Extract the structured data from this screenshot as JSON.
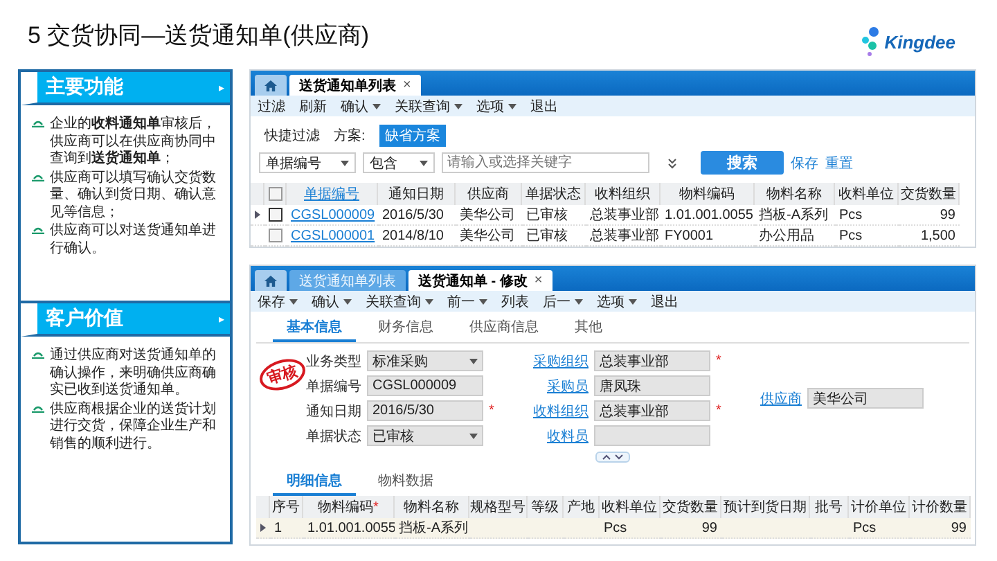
{
  "slide": {
    "title": "5 交货协同—送货通知单(供应商)",
    "logo": "Kingdee"
  },
  "panels": [
    {
      "title": "主要功能",
      "arrow": "▸",
      "bullets": [
        "企业的**收料通知单**审核后，供应商可以在供应商协同中查询到**送货通知单**；",
        "供应商可以填写确认交货数量、确认到货日期、确认意见等信息；",
        "供应商可以对送货通知单进行确认。"
      ]
    },
    {
      "title": "客户价值",
      "arrow": "▸",
      "bullets": [
        "通过供应商对送货通知单的确认操作，来明确供应商确实已收到送货通知单。",
        "供应商根据企业的送货计划进行交货，保障企业生产和销售的顺利进行。"
      ]
    }
  ],
  "list_window": {
    "tabs": [
      {
        "kind": "home",
        "selected": false
      },
      {
        "kind": "text",
        "label": "送货通知单列表",
        "selected": true,
        "close": "×"
      }
    ],
    "toolbar": [
      {
        "label": "过滤",
        "dropdown": false
      },
      {
        "label": "刷新",
        "dropdown": false
      },
      {
        "label": "确认",
        "dropdown": true
      },
      {
        "label": "关联查询",
        "dropdown": true
      },
      {
        "label": "选项",
        "dropdown": true
      },
      {
        "label": "退出",
        "dropdown": false
      }
    ],
    "quick_filter": "快捷过滤",
    "scheme_label": "方案:",
    "schemes": [
      {
        "label": "缺省方案",
        "selected": true
      }
    ],
    "filter_field": "单据编号",
    "filter_operator": "包含",
    "keyword": {
      "placeholder": "请输入或选择关键字"
    },
    "search_button": "搜索",
    "links": [
      "保存",
      "重置"
    ],
    "select_all": {
      "checked": false
    },
    "columns": [
      {
        "label": "单据编号",
        "link": true
      },
      {
        "label": "通知日期",
        "link": false
      },
      {
        "label": "供应商",
        "link": false
      },
      {
        "label": "单据状态",
        "link": false
      },
      {
        "label": "收料组织",
        "link": false
      },
      {
        "label": "物料编码",
        "link": false
      },
      {
        "label": "物料名称",
        "link": false
      },
      {
        "label": "收料单位",
        "link": false
      },
      {
        "label": "交货数量",
        "link": false,
        "numeric": true
      }
    ],
    "rows": [
      {
        "current": true,
        "checked": false,
        "cells": [
          "CGSL000009",
          "2016/5/30",
          "美华公司",
          "已审核",
          "总装事业部",
          "1.01.001.0055",
          "挡板-A系列",
          "Pcs",
          "99"
        ]
      },
      {
        "current": false,
        "checked": false,
        "cells": [
          "CGSL000001",
          "2014/8/10",
          "美华公司",
          "已审核",
          "总装事业部",
          "FY0001",
          "办公用品",
          "Pcs",
          "1,500"
        ]
      }
    ]
  },
  "edit_window": {
    "tabs": [
      {
        "kind": "home",
        "selected": false
      },
      {
        "kind": "text",
        "label": "送货通知单列表",
        "selected": false
      },
      {
        "kind": "text",
        "label": "送货通知单 - 修改",
        "selected": true,
        "close": "×"
      }
    ],
    "toolbar": [
      {
        "label": "保存",
        "dropdown": true
      },
      {
        "label": "确认",
        "dropdown": true
      },
      {
        "label": "关联查询",
        "dropdown": true
      },
      {
        "label": "前一",
        "dropdown": true
      },
      {
        "label": "列表",
        "dropdown": false
      },
      {
        "label": "后一",
        "dropdown": true
      },
      {
        "label": "选项",
        "dropdown": true
      },
      {
        "label": "退出",
        "dropdown": false
      }
    ],
    "sections": [
      {
        "label": "基本信息",
        "selected": true
      },
      {
        "label": "财务信息",
        "selected": false
      },
      {
        "label": "供应商信息",
        "selected": false
      },
      {
        "label": "其他",
        "selected": false
      }
    ],
    "stamp": "审核",
    "form_columns": [
      [
        {
          "label": "业务类型",
          "value": "标准采购",
          "kind": "select",
          "link": false
        },
        {
          "label": "单据编号",
          "value": "CGSL000009",
          "kind": "text",
          "link": false
        },
        {
          "label": "通知日期",
          "value": "2016/5/30",
          "kind": "text",
          "link": false,
          "required_mark": "*"
        },
        {
          "label": "单据状态",
          "value": "已审核",
          "kind": "select",
          "link": false
        }
      ],
      [
        {
          "label": "采购组织",
          "value": "总装事业部",
          "kind": "text",
          "link": true,
          "required_mark": "*"
        },
        {
          "label": "采购员",
          "value": "唐凤珠",
          "kind": "text",
          "link": true
        },
        {
          "label": "收料组织",
          "value": "总装事业部",
          "kind": "text",
          "link": true,
          "required_mark": "*"
        },
        {
          "label": "收料员",
          "kind": "text",
          "link": true
        }
      ],
      [
        {
          "label": "供应商",
          "value": "美华公司",
          "kind": "text",
          "link": true
        }
      ]
    ],
    "detail_tabs": [
      {
        "label": "明细信息",
        "selected": true
      },
      {
        "label": "物料数据",
        "selected": false
      }
    ],
    "detail_columns": [
      {
        "label": "序号"
      },
      {
        "label": "物料编码",
        "required_mark": "*"
      },
      {
        "label": "物料名称"
      },
      {
        "label": "规格型号"
      },
      {
        "label": "等级"
      },
      {
        "label": "产地"
      },
      {
        "label": "收料单位"
      },
      {
        "label": "交货数量",
        "numeric": true
      },
      {
        "label": "预计到货日期"
      },
      {
        "label": "批号"
      },
      {
        "label": "计价单位"
      },
      {
        "label": "计价数量",
        "numeric": true
      }
    ],
    "detail_rows": [
      {
        "current": true,
        "cells": [
          "1",
          "1.01.001.0055",
          "挡板-A系列",
          null,
          null,
          null,
          "Pcs",
          "99",
          null,
          null,
          "Pcs",
          "99"
        ]
      }
    ]
  }
}
